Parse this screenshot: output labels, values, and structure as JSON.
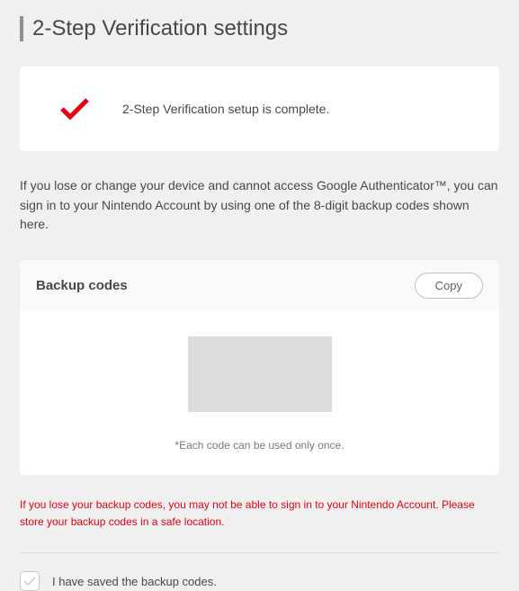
{
  "page": {
    "title": "2-Step Verification settings"
  },
  "status": {
    "message": "2-Step Verification setup is complete."
  },
  "info": {
    "text": "If you lose or change your device and cannot access Google Authenticator™, you can sign in to your Nintendo Account by using one of the 8-digit backup codes shown here."
  },
  "backup": {
    "title": "Backup codes",
    "copy_label": "Copy",
    "once_note": "*Each code can be used only once."
  },
  "warning": {
    "text": "If you lose your backup codes, you may not be able to sign in to your Nintendo Account. Please store your backup codes in a safe location."
  },
  "confirm": {
    "label": "I have saved the backup codes."
  },
  "colors": {
    "accent": "#e60012"
  }
}
